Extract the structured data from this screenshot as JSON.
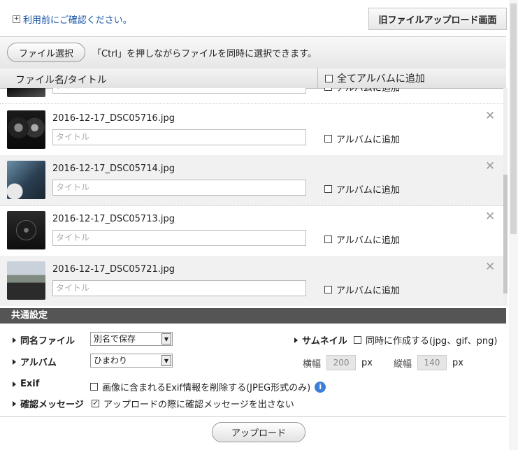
{
  "top": {
    "notice": "利用前にご確認ください。",
    "old_upload_button": "旧ファイルアップロード画面"
  },
  "select_bar": {
    "file_select_button": "ファイル選択",
    "hint": "「Ctrl」を押しながらファイルを同時に選択できます。"
  },
  "list_header": {
    "col_name": "ファイル名/タイトル",
    "add_all_album": "全てアルバムに追加"
  },
  "files": [
    {
      "name": "2016-12-17_DSC05716.jpg",
      "title_placeholder": "タイトル",
      "album_label": "アルバムに追加"
    },
    {
      "name": "2016-12-17_DSC05714.jpg",
      "title_placeholder": "タイトル",
      "album_label": "アルバムに追加"
    },
    {
      "name": "2016-12-17_DSC05713.jpg",
      "title_placeholder": "タイトル",
      "album_label": "アルバムに追加"
    },
    {
      "name": "2016-12-17_DSC05721.jpg",
      "title_placeholder": "タイトル",
      "album_label": "アルバムに追加"
    }
  ],
  "partial_row": {
    "title_placeholder": "タイトル",
    "album_label": "アルバムに追加"
  },
  "common_settings": {
    "header": "共通設定",
    "same_name_label": "同名ファイル",
    "same_name_value": "別名で保存",
    "album_label": "アルバム",
    "album_value": "ひまわり",
    "thumbnail_label": "サムネイル",
    "thumbnail_option": "同時に作成する(jpg、gif、png)",
    "width_label": "横幅",
    "width_value": "200",
    "height_label": "縦幅",
    "height_value": "140",
    "unit": "px",
    "exif_label": "Exif",
    "exif_option": "画像に含まれるExif情報を削除する(JPEG形式のみ)",
    "confirm_label": "確認メッセージ",
    "confirm_option": "アップロードの際に確認メッセージを出さない"
  },
  "upload_button": "アップロード",
  "icons": {
    "close": "close-icon",
    "info": "info-icon",
    "expand": "plus-box-icon"
  }
}
